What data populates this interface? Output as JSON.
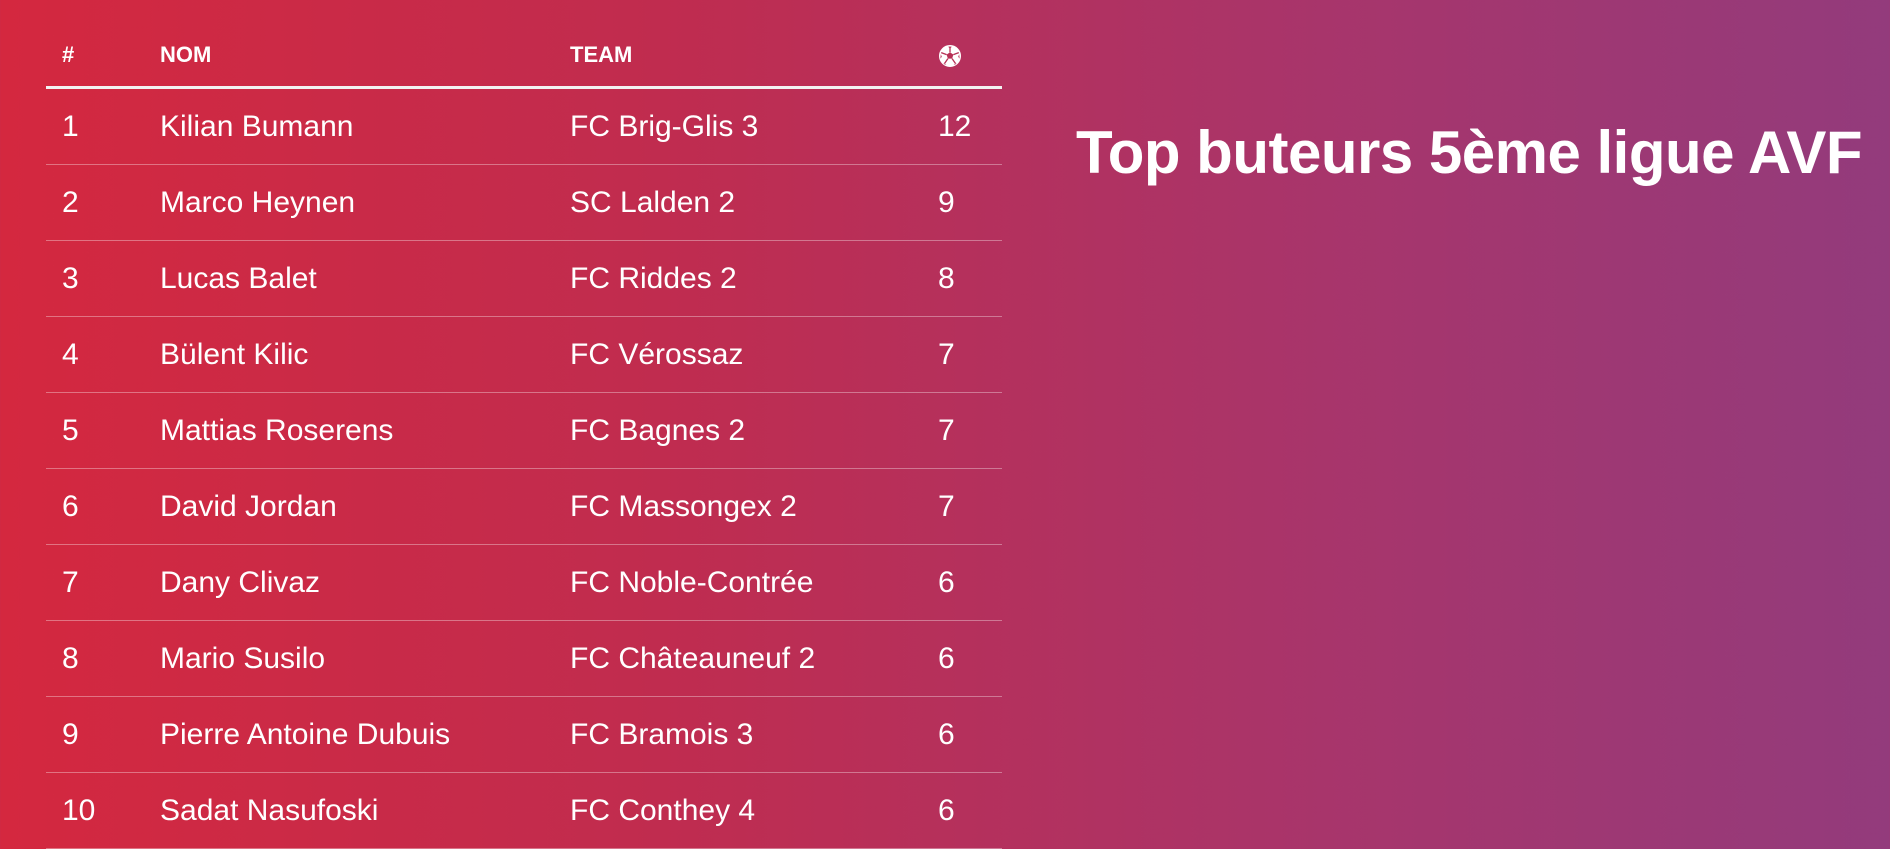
{
  "title": "Top buteurs 5ème ligue AVF",
  "table": {
    "headers": {
      "rank": "#",
      "name": "NOM",
      "team": "TEAM",
      "goals_icon": "soccer-ball-icon"
    },
    "rows": [
      {
        "rank": "1",
        "name": "Kilian Bumann",
        "team": "FC Brig-Glis 3",
        "goals": "12"
      },
      {
        "rank": "2",
        "name": "Marco Heynen",
        "team": "SC Lalden 2",
        "goals": "9"
      },
      {
        "rank": "3",
        "name": "Lucas Balet",
        "team": "FC Riddes 2",
        "goals": "8"
      },
      {
        "rank": "4",
        "name": "Bülent Kilic",
        "team": "FC Vérossaz",
        "goals": "7"
      },
      {
        "rank": "5",
        "name": "Mattias Roserens",
        "team": "FC Bagnes 2",
        "goals": "7"
      },
      {
        "rank": "6",
        "name": "David Jordan",
        "team": "FC Massongex 2",
        "goals": "7"
      },
      {
        "rank": "7",
        "name": "Dany Clivaz",
        "team": "FC Noble-Contrée",
        "goals": "6"
      },
      {
        "rank": "8",
        "name": "Mario Susilo",
        "team": "FC Châteauneuf 2",
        "goals": "6"
      },
      {
        "rank": "9",
        "name": "Pierre Antoine Dubuis",
        "team": "FC Bramois 3",
        "goals": "6"
      },
      {
        "rank": "10",
        "name": "Sadat Nasufoski",
        "team": "FC Conthey 4",
        "goals": "6"
      }
    ]
  },
  "colors": {
    "gradient_start": "#d4283f",
    "gradient_end": "#933b7c",
    "text": "#ffffff"
  }
}
